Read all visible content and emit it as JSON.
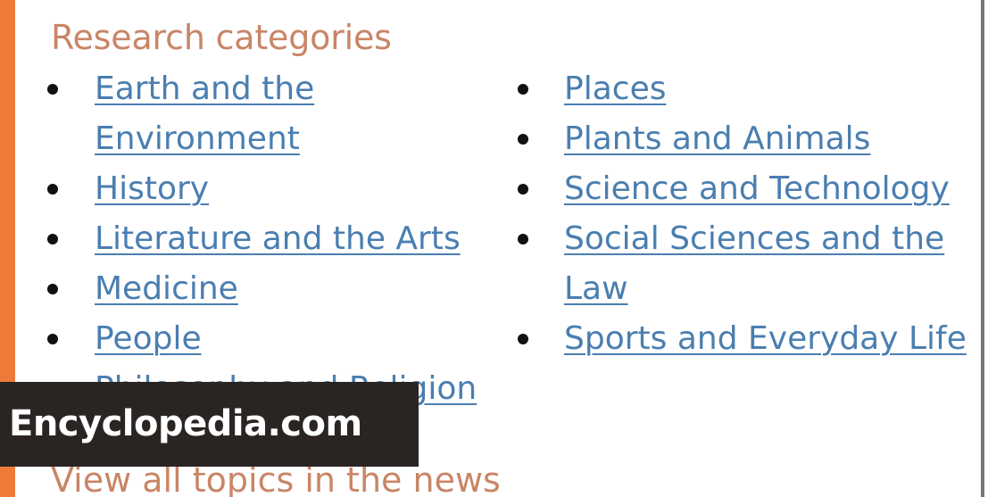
{
  "panel": {
    "heading": "Research categories",
    "left_column": [
      {
        "label": "Earth and the Environment"
      },
      {
        "label": "History"
      },
      {
        "label": "Literature and the Arts"
      },
      {
        "label": "Medicine"
      },
      {
        "label": "People"
      },
      {
        "label": "Philosophy and Religion"
      }
    ],
    "right_column": [
      {
        "label": "Places"
      },
      {
        "label": "Plants and Animals"
      },
      {
        "label": "Science and Technology"
      },
      {
        "label": "Social Sciences and the Law"
      },
      {
        "label": "Sports and Everyday Life"
      }
    ],
    "footer_link": "View all topics in the news"
  },
  "watermark": {
    "text": "Encyclopedia.com"
  },
  "colors": {
    "accent_bar": "#ee7a3a",
    "heading": "#c98566",
    "link": "#4a7eb0",
    "watermark_bg": "#2a2523"
  },
  "icons": {
    "bullet": "bullet-icon"
  }
}
